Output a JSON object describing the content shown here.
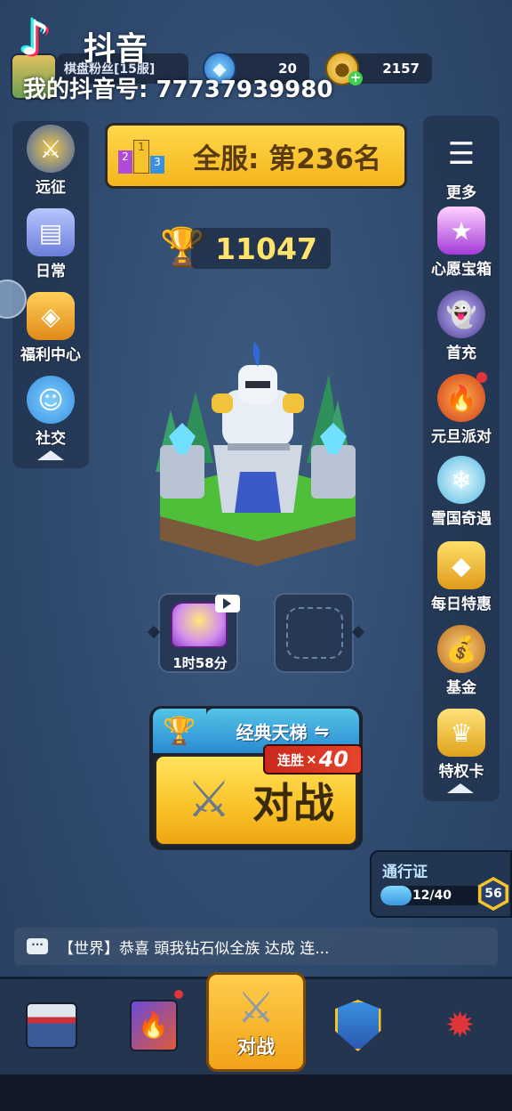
{
  "watermark": {
    "app_name": "抖音",
    "id_line": "我的抖音号: 77737939980"
  },
  "top_bar": {
    "player_name": "棋盘粉丝[15服]",
    "gems": "20",
    "coins": "2157"
  },
  "left_menu": {
    "expedition": "远征",
    "daily": "日常",
    "welfare": "福利中心",
    "social": "社交"
  },
  "right_menu": {
    "more": "更多",
    "wish_chest": "心愿宝箱",
    "first_recharge": "首充",
    "new_year_party": "元旦派对",
    "snow_adventure": "雪国奇遇",
    "daily_deal": "每日特惠",
    "fund": "基金",
    "privilege_card": "特权卡"
  },
  "rank": {
    "text": "全服: 第236名"
  },
  "trophies": "11047",
  "chest_slots": [
    {
      "timer": "1时58分",
      "has_video": true
    },
    {
      "timer": "",
      "empty": true
    }
  ],
  "battle": {
    "mode": "经典天梯",
    "streak_label": "连胜",
    "streak_mult": "×",
    "streak_value": "40",
    "button_label": "对战"
  },
  "pass": {
    "title": "通行证",
    "progress_text": "12/40",
    "progress": 0.3,
    "level": "56"
  },
  "chat": {
    "text": "【世界】恭喜 頭我钻石似全族 达成 连..."
  },
  "bottom_nav": {
    "active_label": "对战",
    "items": [
      "shop-icon",
      "cards-icon",
      "battle-icon",
      "clan-icon",
      "upgrade-icon"
    ]
  },
  "colors": {
    "accent_gold": "#f9c127",
    "panel": "#243550",
    "red_dot": "#e0353a"
  }
}
